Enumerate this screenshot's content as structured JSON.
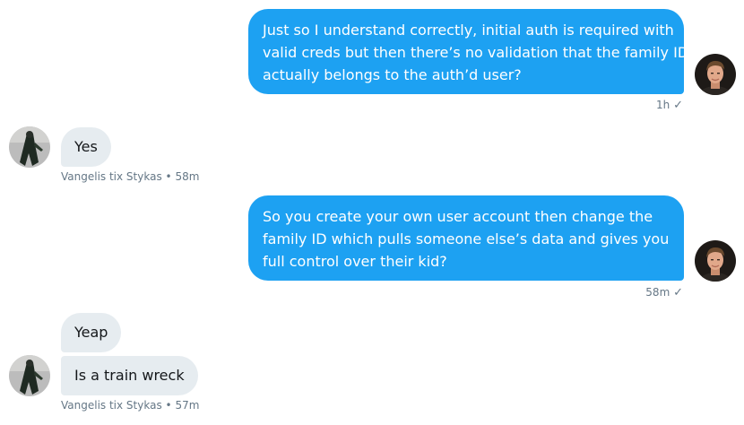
{
  "conversation": {
    "messages": [
      {
        "lines": [
          "Just so I understand correctly, initial auth is required with",
          "valid creds but then there’s no validation that the family ID",
          "actually belongs to the auth’d user?"
        ],
        "time": "1h",
        "status_icon": "check-icon"
      },
      {
        "text": "Yes",
        "sender": "Vangelis tix Stykas",
        "time": "58m"
      },
      {
        "lines": [
          "So you create your own user account then change the",
          "family ID which pulls someone else’s data and gives you",
          "full control over their kid?"
        ],
        "time": "58m",
        "status_icon": "check-icon"
      },
      {
        "texts": [
          "Yeap",
          "Is a train wreck"
        ],
        "sender": "Vangelis tix Stykas",
        "time": "57m"
      }
    ]
  },
  "colors": {
    "outgoing_bubble": "#1da1f2",
    "incoming_bubble": "#e6ecf0",
    "meta_text": "#657786"
  }
}
